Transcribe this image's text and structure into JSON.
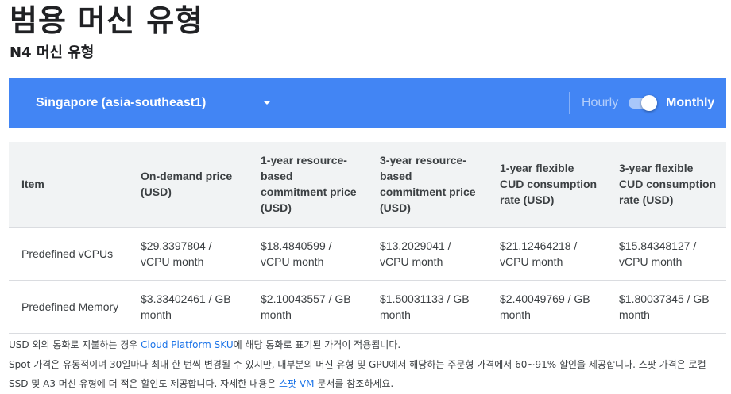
{
  "page": {
    "title": "범용 머신 유형",
    "subtitle": "N4 머신 유형"
  },
  "toolbar": {
    "region": "Singapore (asia-southeast1)",
    "hourly_label": "Hourly",
    "monthly_label": "Monthly",
    "billing_toggle_monthly": true
  },
  "table": {
    "headers": [
      "Item",
      "On-demand price (USD)",
      "1-year resource-based commitment price (USD)",
      "3-year resource-based commitment price (USD)",
      "1-year flexible CUD consumption rate (USD)",
      "3-year flexible CUD consumption rate (USD)"
    ],
    "rows": [
      [
        "Predefined vCPUs",
        "$29.3397804 / vCPU month",
        "$18.4840599 / vCPU month",
        "$13.2029041 / vCPU month",
        "$21.12464218 / vCPU month",
        "$15.84348127 / vCPU month"
      ],
      [
        "Predefined Memory",
        "$3.33402461 / GB month",
        "$2.10043557 / GB month",
        "$1.50031133 / GB month",
        "$2.40049769 / GB month",
        "$1.80037345 / GB month"
      ]
    ]
  },
  "notes": {
    "line1_before": "USD 외의 통화로 지불하는 경우 ",
    "line1_link": "Cloud Platform SKU",
    "line1_after": "에 해당 통화로 표기된 가격이 적용됩니다.",
    "line2_before": "Spot 가격은 유동적이며 30일마다 최대 한 번씩 변경될 수 있지만, 대부분의 머신 유형 및 GPU에서 해당하는 주문형 가격에서 60~91% 할인을 제공합니다. 스팟 가격은 로컬 SSD 및 A3 머신 유형에 더 적은 할인도 제공합니다. 자세한 내용은 ",
    "line2_link": "스팟 VM",
    "line2_after": " 문서를 참조하세요."
  }
}
